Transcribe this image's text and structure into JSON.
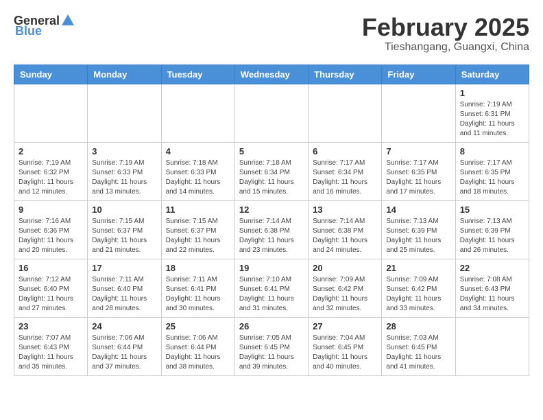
{
  "header": {
    "logo": {
      "general": "General",
      "blue": "Blue"
    },
    "title": "February 2025",
    "location": "Tieshangang, Guangxi, China"
  },
  "weekdays": [
    "Sunday",
    "Monday",
    "Tuesday",
    "Wednesday",
    "Thursday",
    "Friday",
    "Saturday"
  ],
  "weeks": [
    [
      {
        "day": "",
        "info": ""
      },
      {
        "day": "",
        "info": ""
      },
      {
        "day": "",
        "info": ""
      },
      {
        "day": "",
        "info": ""
      },
      {
        "day": "",
        "info": ""
      },
      {
        "day": "",
        "info": ""
      },
      {
        "day": "1",
        "info": "Sunrise: 7:19 AM\nSunset: 6:31 PM\nDaylight: 11 hours\nand 11 minutes."
      }
    ],
    [
      {
        "day": "2",
        "info": "Sunrise: 7:19 AM\nSunset: 6:32 PM\nDaylight: 11 hours\nand 12 minutes."
      },
      {
        "day": "3",
        "info": "Sunrise: 7:19 AM\nSunset: 6:33 PM\nDaylight: 11 hours\nand 13 minutes."
      },
      {
        "day": "4",
        "info": "Sunrise: 7:18 AM\nSunset: 6:33 PM\nDaylight: 11 hours\nand 14 minutes."
      },
      {
        "day": "5",
        "info": "Sunrise: 7:18 AM\nSunset: 6:34 PM\nDaylight: 11 hours\nand 15 minutes."
      },
      {
        "day": "6",
        "info": "Sunrise: 7:17 AM\nSunset: 6:34 PM\nDaylight: 11 hours\nand 16 minutes."
      },
      {
        "day": "7",
        "info": "Sunrise: 7:17 AM\nSunset: 6:35 PM\nDaylight: 11 hours\nand 17 minutes."
      },
      {
        "day": "8",
        "info": "Sunrise: 7:17 AM\nSunset: 6:35 PM\nDaylight: 11 hours\nand 18 minutes."
      }
    ],
    [
      {
        "day": "9",
        "info": "Sunrise: 7:16 AM\nSunset: 6:36 PM\nDaylight: 11 hours\nand 20 minutes."
      },
      {
        "day": "10",
        "info": "Sunrise: 7:15 AM\nSunset: 6:37 PM\nDaylight: 11 hours\nand 21 minutes."
      },
      {
        "day": "11",
        "info": "Sunrise: 7:15 AM\nSunset: 6:37 PM\nDaylight: 11 hours\nand 22 minutes."
      },
      {
        "day": "12",
        "info": "Sunrise: 7:14 AM\nSunset: 6:38 PM\nDaylight: 11 hours\nand 23 minutes."
      },
      {
        "day": "13",
        "info": "Sunrise: 7:14 AM\nSunset: 6:38 PM\nDaylight: 11 hours\nand 24 minutes."
      },
      {
        "day": "14",
        "info": "Sunrise: 7:13 AM\nSunset: 6:39 PM\nDaylight: 11 hours\nand 25 minutes."
      },
      {
        "day": "15",
        "info": "Sunrise: 7:13 AM\nSunset: 6:39 PM\nDaylight: 11 hours\nand 26 minutes."
      }
    ],
    [
      {
        "day": "16",
        "info": "Sunrise: 7:12 AM\nSunset: 6:40 PM\nDaylight: 11 hours\nand 27 minutes."
      },
      {
        "day": "17",
        "info": "Sunrise: 7:11 AM\nSunset: 6:40 PM\nDaylight: 11 hours\nand 28 minutes."
      },
      {
        "day": "18",
        "info": "Sunrise: 7:11 AM\nSunset: 6:41 PM\nDaylight: 11 hours\nand 30 minutes."
      },
      {
        "day": "19",
        "info": "Sunrise: 7:10 AM\nSunset: 6:41 PM\nDaylight: 11 hours\nand 31 minutes."
      },
      {
        "day": "20",
        "info": "Sunrise: 7:09 AM\nSunset: 6:42 PM\nDaylight: 11 hours\nand 32 minutes."
      },
      {
        "day": "21",
        "info": "Sunrise: 7:09 AM\nSunset: 6:42 PM\nDaylight: 11 hours\nand 33 minutes."
      },
      {
        "day": "22",
        "info": "Sunrise: 7:08 AM\nSunset: 6:43 PM\nDaylight: 11 hours\nand 34 minutes."
      }
    ],
    [
      {
        "day": "23",
        "info": "Sunrise: 7:07 AM\nSunset: 6:43 PM\nDaylight: 11 hours\nand 35 minutes."
      },
      {
        "day": "24",
        "info": "Sunrise: 7:06 AM\nSunset: 6:44 PM\nDaylight: 11 hours\nand 37 minutes."
      },
      {
        "day": "25",
        "info": "Sunrise: 7:06 AM\nSunset: 6:44 PM\nDaylight: 11 hours\nand 38 minutes."
      },
      {
        "day": "26",
        "info": "Sunrise: 7:05 AM\nSunset: 6:45 PM\nDaylight: 11 hours\nand 39 minutes."
      },
      {
        "day": "27",
        "info": "Sunrise: 7:04 AM\nSunset: 6:45 PM\nDaylight: 11 hours\nand 40 minutes."
      },
      {
        "day": "28",
        "info": "Sunrise: 7:03 AM\nSunset: 6:45 PM\nDaylight: 11 hours\nand 41 minutes."
      },
      {
        "day": "",
        "info": ""
      }
    ]
  ]
}
